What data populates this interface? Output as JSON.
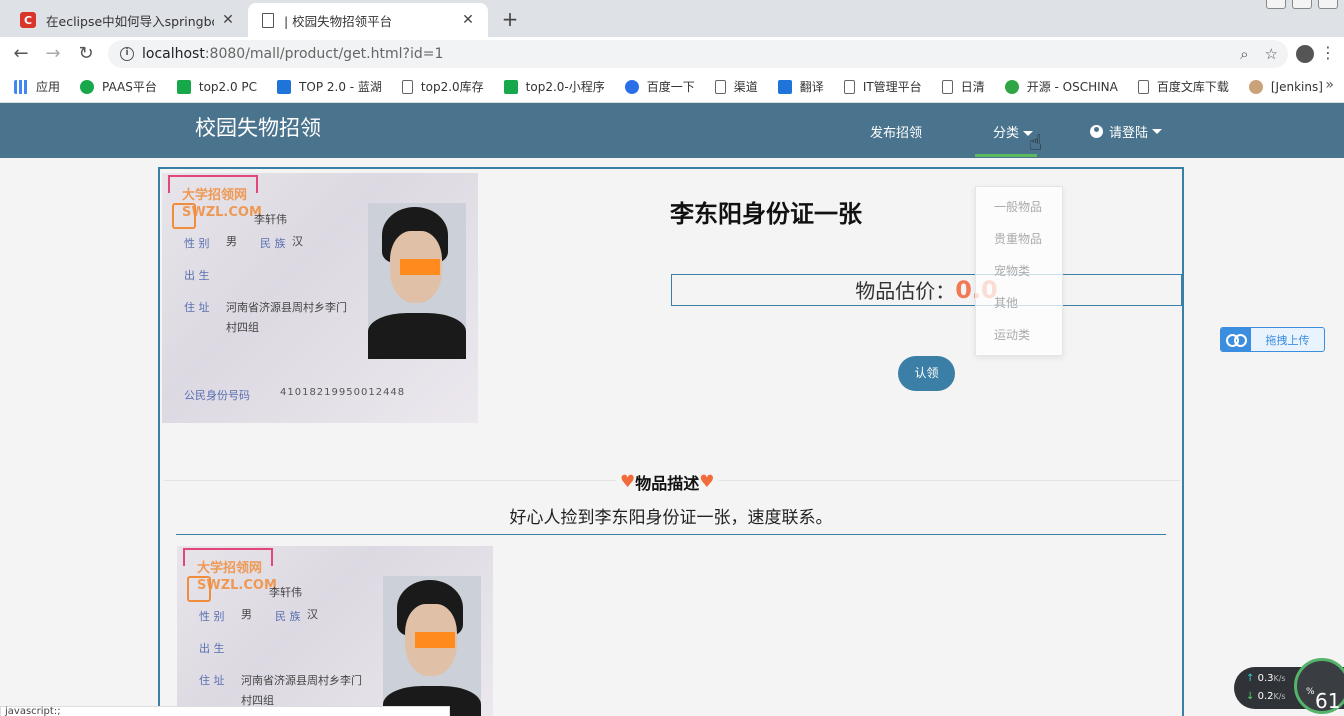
{
  "browser": {
    "tabs": [
      {
        "title": "在eclipse中如何导入springboot",
        "favicon": "C"
      },
      {
        "title": "| 校园失物招领平台"
      }
    ],
    "url_host": "localhost",
    "url_rest": ":8080/mall/product/get.html?id=1",
    "bookmarks": [
      {
        "label": "应用",
        "icon": "apps-icon"
      },
      {
        "label": "PAAS平台",
        "icon": "paas-icon"
      },
      {
        "label": "top2.0 PC",
        "icon": "play-icon"
      },
      {
        "label": "TOP 2.0 - 蓝湖",
        "icon": "lanhu-icon"
      },
      {
        "label": "top2.0库存",
        "icon": "doc-icon"
      },
      {
        "label": "top2.0-小程序",
        "icon": "play-icon"
      },
      {
        "label": "百度一下",
        "icon": "baidu-paw-icon"
      },
      {
        "label": "渠道",
        "icon": "doc-icon"
      },
      {
        "label": "翻译",
        "icon": "translate-icon"
      },
      {
        "label": "IT管理平台",
        "icon": "doc-icon"
      },
      {
        "label": "日清",
        "icon": "doc-icon"
      },
      {
        "label": "开源 - OSCHINA",
        "icon": "oschina-icon"
      },
      {
        "label": "百度文库下载",
        "icon": "doc-icon"
      },
      {
        "label": "[Jenkins]",
        "icon": "jenkins-icon"
      }
    ],
    "bookmarks_more": "»",
    "status_text": "javascript:;"
  },
  "site": {
    "brand": "校园失物招领",
    "nav": {
      "publish": "发布招领",
      "category": "分类",
      "login": "请登陆"
    },
    "categories": [
      "一般物品",
      "贵重物品",
      "宠物类",
      "其他",
      "运动类"
    ]
  },
  "product": {
    "title": "李东阳身份证一张",
    "price_label": "物品估价：",
    "price_value": "0.0",
    "claim_button": "认领",
    "desc_heading": "物品描述",
    "description": "好心人捡到李东阳身份证一张，速度联系。"
  },
  "id_card_image": {
    "watermark_text": "大学招领网",
    "watermark_domain": "SWZL.COM",
    "name": "李轩伟",
    "sex_label": "性 别",
    "sex": "男",
    "ethnicity_label": "民 族",
    "ethnicity": "汉",
    "birth_label": "出 生",
    "address_label": "住 址",
    "address": "河南省济源县周村乡李门",
    "address2": "村四组",
    "id_label": "公民身份号码",
    "id_number": "41018219950012448",
    "second_name": "李轩伟"
  },
  "widgets": {
    "upload_label": "拖拽上传",
    "upload_speed": "0.3",
    "download_speed": "0.2",
    "speed_unit": "K/s",
    "gauge_value": "61",
    "gauge_unit": "%"
  }
}
